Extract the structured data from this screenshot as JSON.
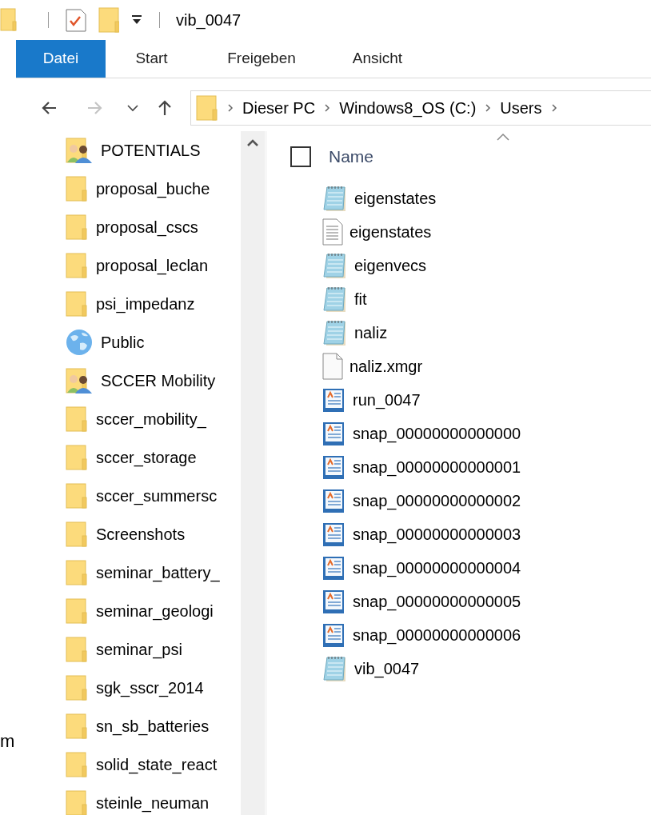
{
  "title_bar": {
    "title": "vib_0047"
  },
  "ribbon_tabs": [
    {
      "label": "Datei",
      "kind": "file"
    },
    {
      "label": "Start",
      "kind": "tab"
    },
    {
      "label": "Freigeben",
      "kind": "tab"
    },
    {
      "label": "Ansicht",
      "kind": "tab"
    }
  ],
  "nav_buttons": [
    {
      "kind": "back",
      "disabled": false
    },
    {
      "kind": "forward",
      "disabled": true
    },
    {
      "kind": "recent",
      "disabled": false
    },
    {
      "kind": "up",
      "disabled": false
    }
  ],
  "address_bar": {
    "crumbs": [
      "Dieser PC",
      "Windows8_OS (C:)",
      "Users"
    ]
  },
  "stray_text": "m",
  "navigation_pane": {
    "items": [
      {
        "label": "POTENTIALS",
        "kind": "shared"
      },
      {
        "label": "proposal_buche",
        "kind": "folder"
      },
      {
        "label": "proposal_cscs",
        "kind": "folder"
      },
      {
        "label": "proposal_leclan",
        "kind": "folder"
      },
      {
        "label": "psi_impedanz",
        "kind": "folder"
      },
      {
        "label": "Public",
        "kind": "globe"
      },
      {
        "label": "SCCER Mobility",
        "kind": "shared"
      },
      {
        "label": "sccer_mobility_",
        "kind": "folder"
      },
      {
        "label": "sccer_storage",
        "kind": "folder"
      },
      {
        "label": "sccer_summersc",
        "kind": "folder"
      },
      {
        "label": "Screenshots",
        "kind": "folder"
      },
      {
        "label": "seminar_battery_",
        "kind": "folder"
      },
      {
        "label": "seminar_geologi",
        "kind": "folder"
      },
      {
        "label": "seminar_psi",
        "kind": "folder"
      },
      {
        "label": "sgk_sscr_2014",
        "kind": "folder"
      },
      {
        "label": "sn_sb_batteries",
        "kind": "folder"
      },
      {
        "label": "solid_state_react",
        "kind": "folder"
      },
      {
        "label": "steinle_neuman",
        "kind": "folder"
      }
    ]
  },
  "file_list": {
    "select_all_checked": false,
    "column": "Name",
    "sort_ascending": true,
    "files": [
      {
        "name": "eigenstates",
        "kind": "notepad"
      },
      {
        "name": "eigenstates",
        "kind": "text"
      },
      {
        "name": "eigenvecs",
        "kind": "notepad"
      },
      {
        "name": "fit",
        "kind": "notepad"
      },
      {
        "name": "naliz",
        "kind": "notepad"
      },
      {
        "name": "naliz.xmgr",
        "kind": "blank"
      },
      {
        "name": "run_0047",
        "kind": "grace"
      },
      {
        "name": "snap_00000000000000",
        "kind": "grace"
      },
      {
        "name": "snap_00000000000001",
        "kind": "grace"
      },
      {
        "name": "snap_00000000000002",
        "kind": "grace"
      },
      {
        "name": "snap_00000000000003",
        "kind": "grace"
      },
      {
        "name": "snap_00000000000004",
        "kind": "grace"
      },
      {
        "name": "snap_00000000000005",
        "kind": "grace"
      },
      {
        "name": "snap_00000000000006",
        "kind": "grace"
      },
      {
        "name": "vib_0047",
        "kind": "notepad"
      }
    ]
  }
}
